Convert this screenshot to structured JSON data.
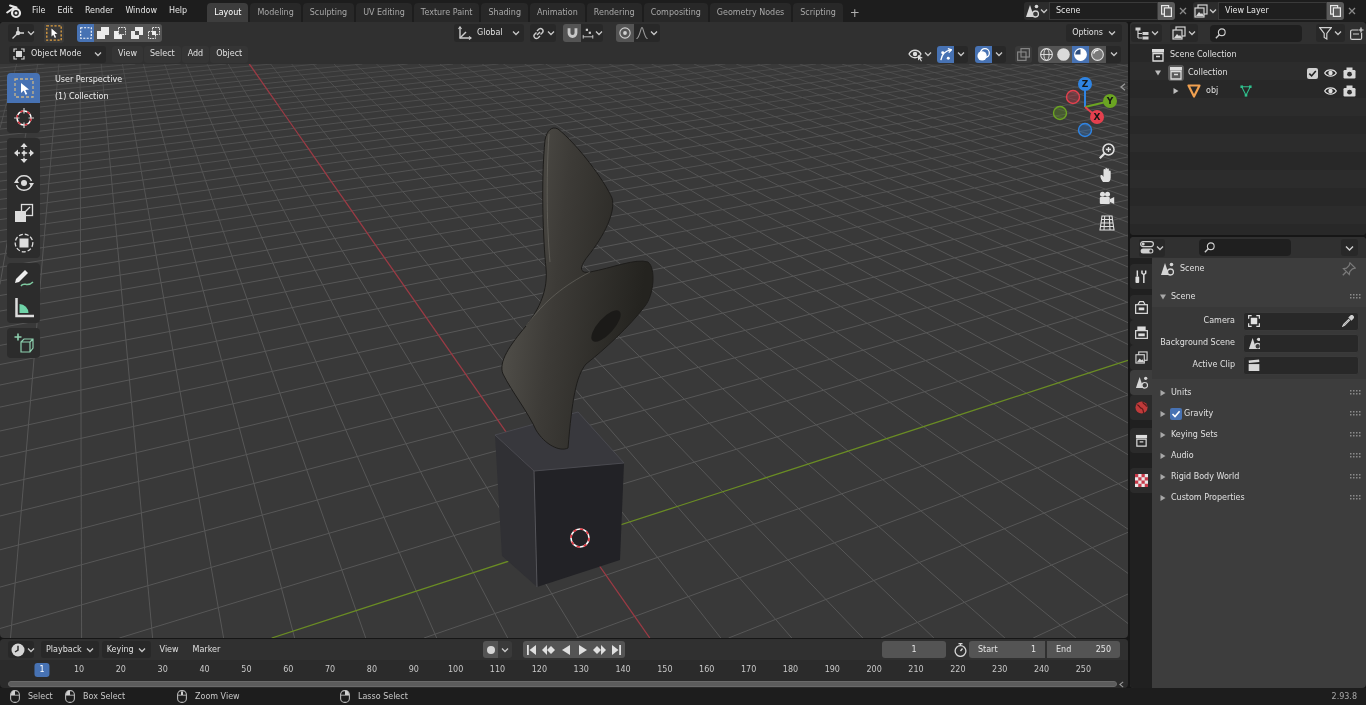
{
  "topbar": {
    "menus": [
      "File",
      "Edit",
      "Render",
      "Window",
      "Help"
    ],
    "workspaces": [
      {
        "label": "Layout",
        "selected": true
      },
      {
        "label": "Modeling",
        "selected": false
      },
      {
        "label": "Sculpting",
        "selected": false
      },
      {
        "label": "UV Editing",
        "selected": false
      },
      {
        "label": "Texture Paint",
        "selected": false
      },
      {
        "label": "Shading",
        "selected": false
      },
      {
        "label": "Animation",
        "selected": false
      },
      {
        "label": "Rendering",
        "selected": false
      },
      {
        "label": "Compositing",
        "selected": false
      },
      {
        "label": "Geometry Nodes",
        "selected": false
      },
      {
        "label": "Scripting",
        "selected": false
      }
    ],
    "add_tab": "+",
    "scene": "Scene",
    "view_layer": "View Layer"
  },
  "viewport": {
    "select_modes": [
      {
        "selected": true
      },
      {
        "selected": false
      },
      {
        "selected": false
      },
      {
        "selected": false
      },
      {
        "selected": false
      }
    ],
    "orientation": "Global",
    "options": "Options",
    "mode": "Object Mode",
    "menus": [
      "View",
      "Select",
      "Add",
      "Object"
    ],
    "toggles": [
      {
        "on": true
      },
      {
        "on": true
      },
      {
        "on": false
      }
    ],
    "shading": [
      {
        "selected": false
      },
      {
        "selected": false
      },
      {
        "selected": true
      },
      {
        "selected": false
      }
    ],
    "info": [
      "User Perspective",
      "(1) Collection"
    ],
    "tool_groups": [
      {
        "tools": [
          {
            "selected": true
          },
          {
            "selected": false
          }
        ]
      },
      {
        "tools": [
          {
            "selected": false
          },
          {
            "selected": false
          },
          {
            "selected": false
          },
          {
            "selected": false
          }
        ]
      },
      {
        "tools": [
          {
            "selected": false
          },
          {
            "selected": false
          }
        ]
      },
      {
        "tools": [
          {
            "selected": false
          }
        ]
      }
    ],
    "gizmo_axes": [
      {
        "label": "Z",
        "color": "#2f84e3"
      },
      {
        "label": "Y",
        "color": "#6ba422"
      },
      {
        "label": "X",
        "color": "#e5404e"
      }
    ]
  },
  "outliner": {
    "tree": [
      {
        "label": "Scene Collection",
        "kind": "scene_collection",
        "active": false,
        "children": [
          {
            "label": "Collection",
            "kind": "collection",
            "expanded": true,
            "active": true,
            "checked": true,
            "children": [
              {
                "label": "obj",
                "kind": "mesh_object",
                "expanded": false,
                "active": false
              }
            ]
          }
        ]
      }
    ]
  },
  "properties": {
    "tabs": [
      {
        "selected": false
      },
      {
        "selected": false
      },
      {
        "selected": false
      },
      {
        "selected": false
      },
      {
        "selected": true
      },
      {
        "selected": false
      },
      {
        "selected": false
      },
      {
        "selected": false
      }
    ],
    "context": "Scene",
    "panels": [
      {
        "label": "Scene",
        "expanded": true,
        "fields": [
          {
            "label": "Camera",
            "kind": "object_picker"
          },
          {
            "label": "Background Scene",
            "kind": "scene"
          },
          {
            "label": "Active Clip",
            "kind": "clip"
          }
        ]
      },
      {
        "label": "Units",
        "expanded": false
      },
      {
        "label": "Gravity",
        "expanded": false,
        "toggle": {
          "checked": true
        }
      },
      {
        "label": "Keying Sets",
        "expanded": false
      },
      {
        "label": "Audio",
        "expanded": false
      },
      {
        "label": "Rigid Body World",
        "expanded": false
      },
      {
        "label": "Custom Properties",
        "expanded": false
      }
    ]
  },
  "timeline": {
    "menus": [
      {
        "label": "Playback",
        "kind": "dropdown"
      },
      {
        "label": "Keying",
        "kind": "dropdown"
      },
      {
        "label": "View",
        "kind": "menu"
      },
      {
        "label": "Marker",
        "kind": "menu"
      }
    ],
    "current_frame": "1",
    "start": {
      "label": "Start",
      "value": "1"
    },
    "end": {
      "label": "End",
      "value": "250"
    },
    "ruler": [
      {
        "label": "1",
        "selected": true
      },
      {
        "label": "10",
        "selected": false
      },
      {
        "label": "20",
        "selected": false
      },
      {
        "label": "30",
        "selected": false
      },
      {
        "label": "40",
        "selected": false
      },
      {
        "label": "50",
        "selected": false
      },
      {
        "label": "60",
        "selected": false
      },
      {
        "label": "70",
        "selected": false
      },
      {
        "label": "80",
        "selected": false
      },
      {
        "label": "90",
        "selected": false
      },
      {
        "label": "100",
        "selected": false
      },
      {
        "label": "110",
        "selected": false
      },
      {
        "label": "120",
        "selected": false
      },
      {
        "label": "130",
        "selected": false
      },
      {
        "label": "140",
        "selected": false
      },
      {
        "label": "150",
        "selected": false
      },
      {
        "label": "160",
        "selected": false
      },
      {
        "label": "170",
        "selected": false
      },
      {
        "label": "180",
        "selected": false
      },
      {
        "label": "190",
        "selected": false
      },
      {
        "label": "200",
        "selected": false
      },
      {
        "label": "210",
        "selected": false
      },
      {
        "label": "220",
        "selected": false
      },
      {
        "label": "230",
        "selected": false
      },
      {
        "label": "240",
        "selected": false
      },
      {
        "label": "250",
        "selected": false
      }
    ]
  },
  "status_bar": {
    "hints": [
      "Select",
      "Box Select",
      "Zoom View",
      "Lasso Select"
    ],
    "version": "2.93.8"
  }
}
